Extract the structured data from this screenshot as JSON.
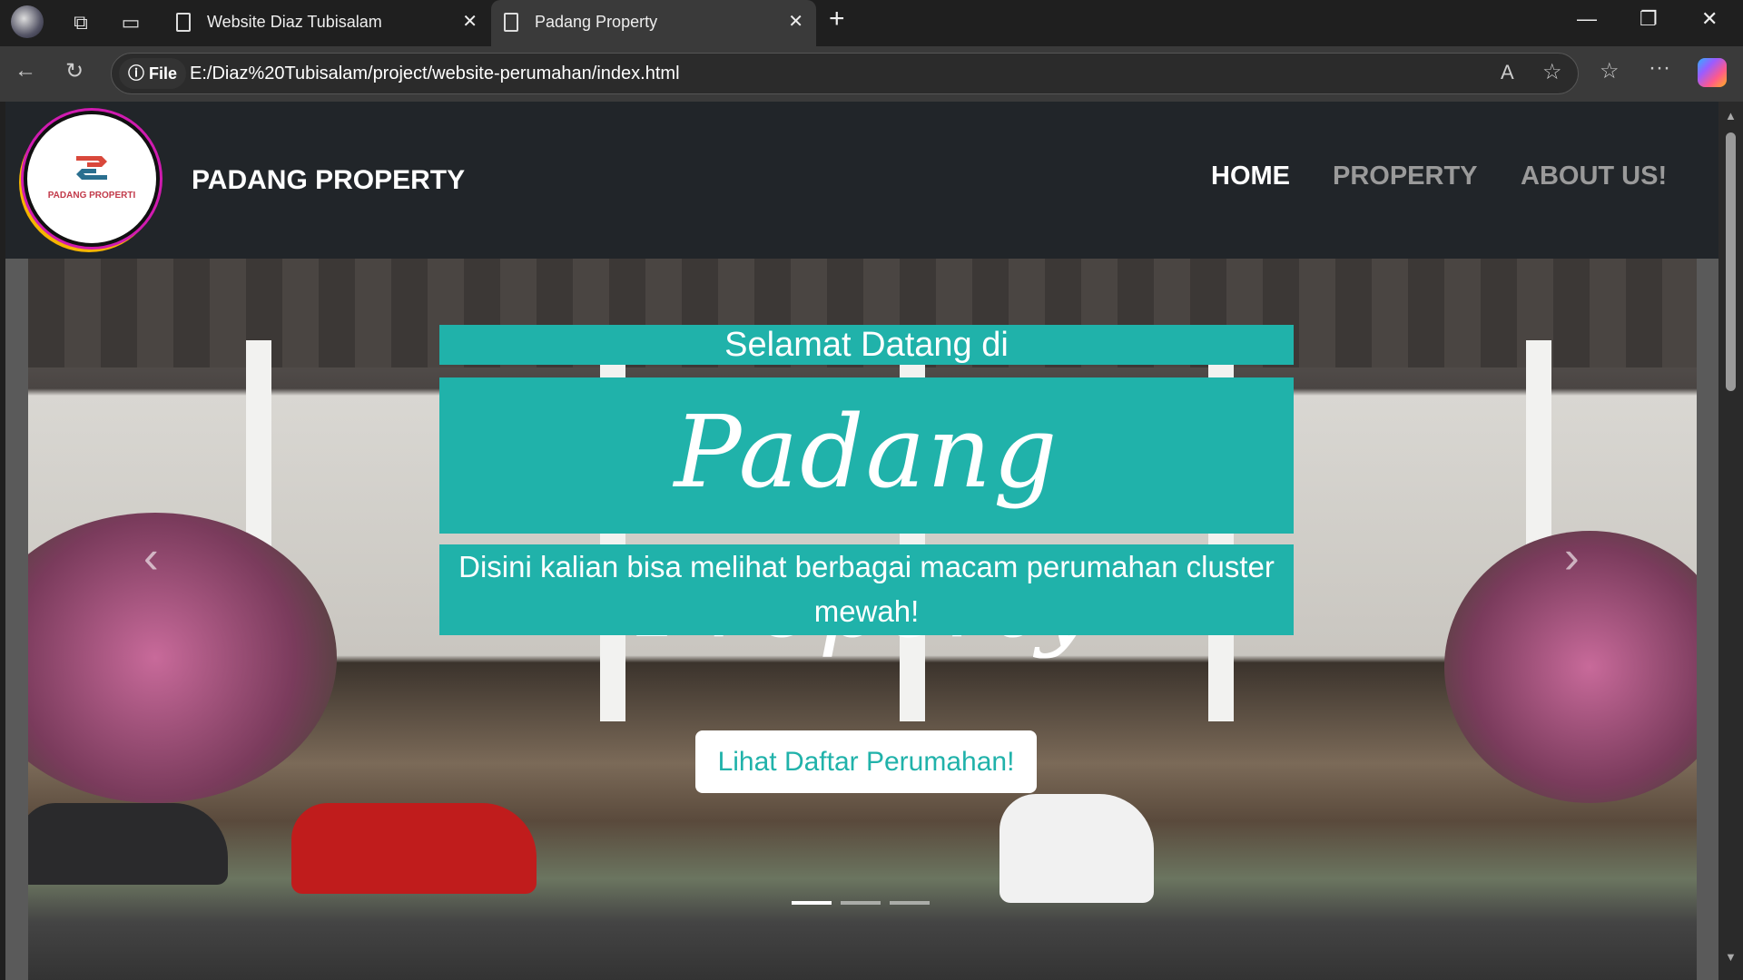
{
  "browser": {
    "tabs": [
      {
        "label": "Website Diaz Tubisalam",
        "active": false
      },
      {
        "label": "Padang Property",
        "active": true
      }
    ],
    "new_tab": "+",
    "url_badge": "File",
    "url": "E:/Diaz%20Tubisalam/project/website-perumahan/index.html"
  },
  "navbar": {
    "logo_text": "PADANG PROPERTI",
    "brand": "PADANG PROPERTY",
    "links": [
      {
        "label": "HOME",
        "active": true
      },
      {
        "label": "PROPERTY",
        "active": false
      },
      {
        "label": "ABOUT US!",
        "active": false
      }
    ]
  },
  "hero": {
    "greeting": "Selamat Datang di",
    "title": "Padang Property",
    "subtitle": "Disini kalian bisa melihat berbagai macam perumahan cluster mewah!",
    "cta": "Lihat Daftar Perumahan!",
    "slides": 3,
    "active_slide": 1
  },
  "colors": {
    "accent": "#20b2aa",
    "navbar": "#212529"
  }
}
